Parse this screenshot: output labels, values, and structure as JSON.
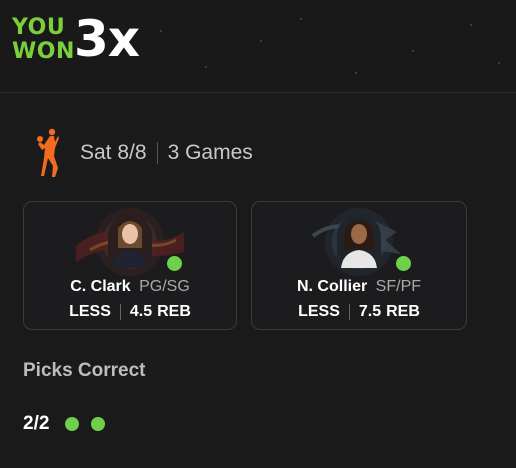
{
  "result": {
    "line1": "YOU",
    "line2": "WON",
    "multiplier": "3x"
  },
  "slip": {
    "league_icon": "basketball-player-icon",
    "date": "Sat 8/8",
    "games": "3 Games"
  },
  "picks": [
    {
      "name": "C. Clark",
      "position": "PG/SG",
      "direction": "LESS",
      "value": "4.5",
      "stat": "REB",
      "team_logo": "fever-logo",
      "correct": true
    },
    {
      "name": "N. Collier",
      "position": "SF/PF",
      "direction": "LESS",
      "value": "7.5",
      "stat": "REB",
      "team_logo": "lynx-logo",
      "correct": true
    }
  ],
  "summary": {
    "title": "Picks Correct",
    "count": "2/2",
    "correct_dots": 2
  },
  "colors": {
    "accent_green": "#7ccf3a",
    "check_green": "#6fd04a",
    "background": "#1a1a1b"
  }
}
